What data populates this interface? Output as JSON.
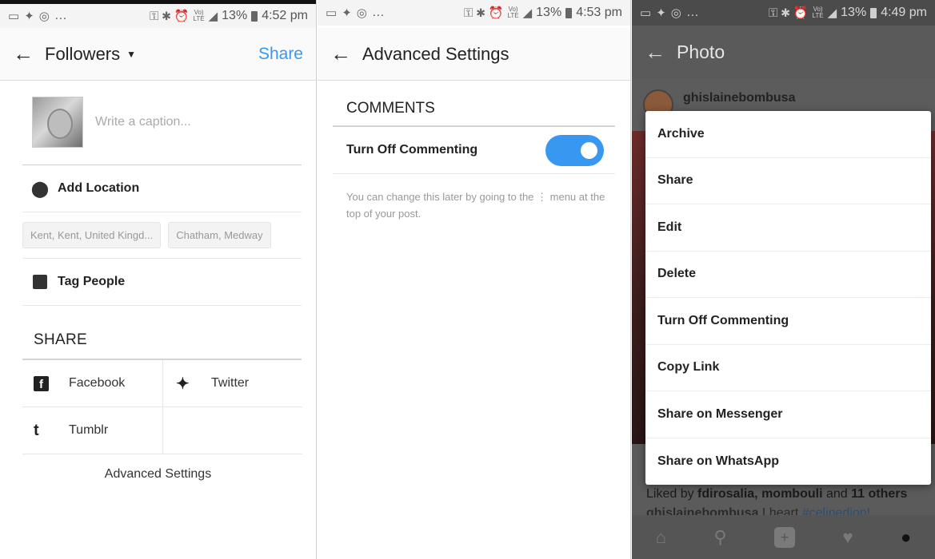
{
  "status_bars": [
    {
      "left": "…",
      "battery": "13%",
      "time": "4:52 pm"
    },
    {
      "left": "…",
      "battery": "13%",
      "time": "4:53 pm"
    },
    {
      "left": "…",
      "battery": "13%",
      "time": "4:49 pm"
    }
  ],
  "panel1": {
    "title": "Followers",
    "share_action": "Share",
    "caption_placeholder": "Write a caption...",
    "add_location": "Add Location",
    "location_suggestions": [
      "Kent, Kent, United Kingd...",
      "Chatham, Medway"
    ],
    "tag_people": "Tag People",
    "share_heading": "SHARE",
    "share_targets": {
      "facebook": "Facebook",
      "twitter": "Twitter",
      "tumblr": "Tumblr"
    },
    "advanced_settings": "Advanced Settings"
  },
  "panel2": {
    "title": "Advanced Settings",
    "section": "COMMENTS",
    "toggle_label": "Turn Off Commenting",
    "toggle_on": true,
    "help_text": "You can change this later by going to the ⋮ menu at the top of your post."
  },
  "panel3": {
    "title": "Photo",
    "poster": "ghislainebombusa",
    "menu_items": [
      "Archive",
      "Share",
      "Edit",
      "Delete",
      "Turn Off Commenting",
      "Copy Link",
      "Share on Messenger",
      "Share on WhatsApp"
    ],
    "likes_prefix": "Liked by ",
    "likes_user": "fdirosalia, mombouli",
    "likes_mid": " and ",
    "likes_count": "11 others",
    "caption_user": "ghislainebombusa",
    "caption_text": " I heart ",
    "caption_tag": "#celinedion!"
  },
  "colors": {
    "accent": "#3897f0"
  }
}
